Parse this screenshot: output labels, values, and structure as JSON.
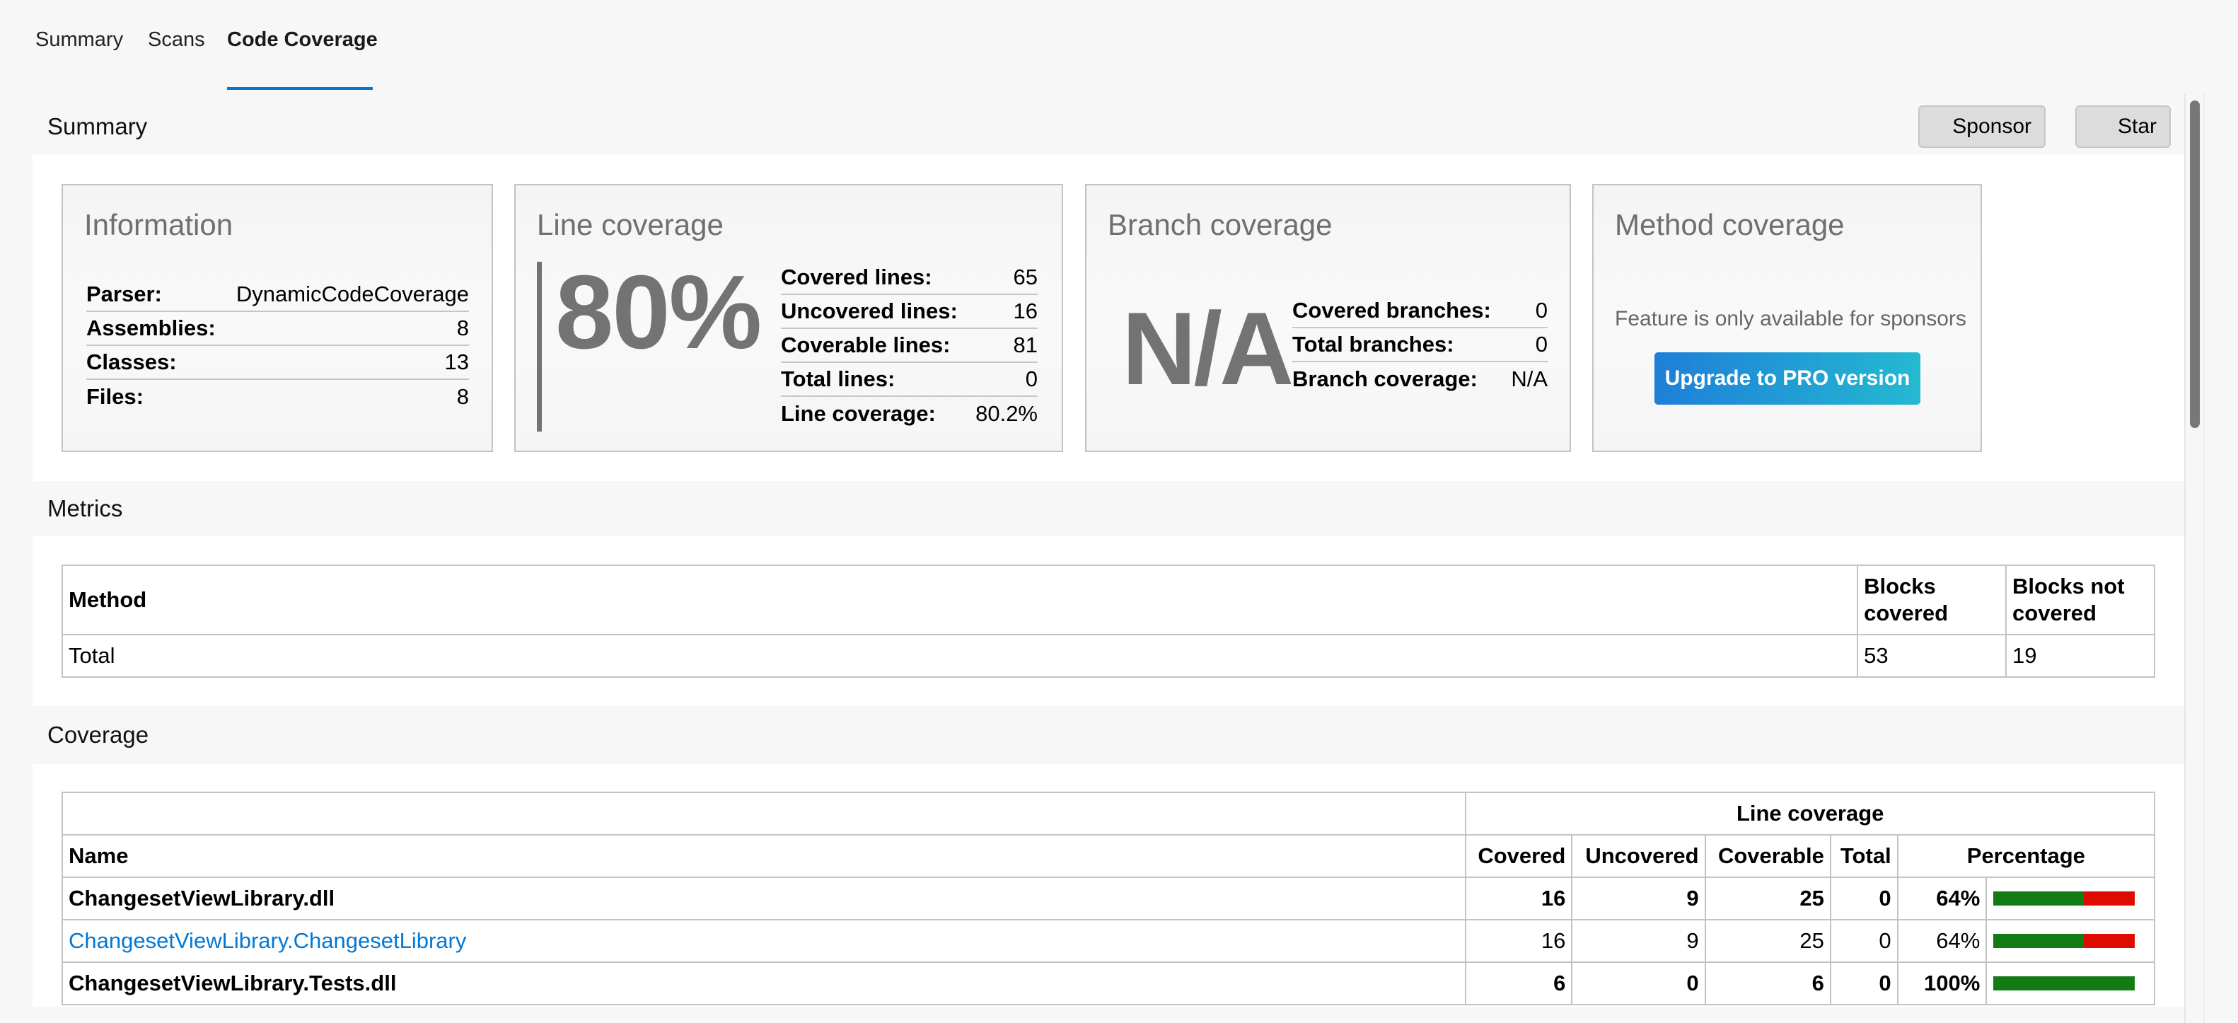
{
  "tabs": [
    {
      "label": "Summary",
      "active": false
    },
    {
      "label": "Scans",
      "active": false
    },
    {
      "label": "Code Coverage",
      "active": true
    }
  ],
  "colors": {
    "accent": "#0078d4",
    "covered": "#127b14",
    "uncovered": "#e00b00",
    "upgrade_gradient_start": "#1e7fd8",
    "upgrade_gradient_end": "#24b9d1"
  },
  "summary": {
    "title": "Summary",
    "sponsor_label": "Sponsor",
    "star_label": "Star",
    "information": {
      "title": "Information",
      "rows": [
        {
          "label": "Parser:",
          "value": "DynamicCodeCoverage"
        },
        {
          "label": "Assemblies:",
          "value": "8"
        },
        {
          "label": "Classes:",
          "value": "13"
        },
        {
          "label": "Files:",
          "value": "8"
        }
      ]
    },
    "line_coverage": {
      "title": "Line coverage",
      "big_value": "80%",
      "rows": [
        {
          "label": "Covered lines:",
          "value": "65"
        },
        {
          "label": "Uncovered lines:",
          "value": "16"
        },
        {
          "label": "Coverable lines:",
          "value": "81"
        },
        {
          "label": "Total lines:",
          "value": "0"
        },
        {
          "label": "Line coverage:",
          "value": "80.2%"
        }
      ]
    },
    "branch_coverage": {
      "title": "Branch coverage",
      "big_value": "N/A",
      "rows": [
        {
          "label": "Covered branches:",
          "value": "0"
        },
        {
          "label": "Total branches:",
          "value": "0"
        },
        {
          "label": "Branch coverage:",
          "value": "N/A"
        }
      ]
    },
    "method_coverage": {
      "title": "Method coverage",
      "note": "Feature is only available for sponsors",
      "upgrade_label": "Upgrade to PRO version"
    }
  },
  "metrics": {
    "title": "Metrics",
    "headers": [
      "Method",
      "Blocks covered",
      "Blocks not covered"
    ],
    "rows": [
      {
        "method": "Total",
        "blocks_covered": "53",
        "blocks_not_covered": "19"
      }
    ]
  },
  "coverage": {
    "title": "Coverage",
    "group_header": "Line coverage",
    "headers": {
      "name": "Name",
      "covered": "Covered",
      "uncovered": "Uncovered",
      "coverable": "Coverable",
      "total": "Total",
      "percentage": "Percentage"
    },
    "rows": [
      {
        "name": "ChangesetViewLibrary.dll",
        "type": "assembly",
        "covered": "16",
        "uncovered": "9",
        "coverable": "25",
        "total": "0",
        "percentage": "64%",
        "fraction": 0.64
      },
      {
        "name": "ChangesetViewLibrary.ChangesetLibrary",
        "type": "class",
        "covered": "16",
        "uncovered": "9",
        "coverable": "25",
        "total": "0",
        "percentage": "64%",
        "fraction": 0.64
      },
      {
        "name": "ChangesetViewLibrary.Tests.dll",
        "type": "assembly",
        "covered": "6",
        "uncovered": "0",
        "coverable": "6",
        "total": "0",
        "percentage": "100%",
        "fraction": 1.0
      }
    ]
  }
}
